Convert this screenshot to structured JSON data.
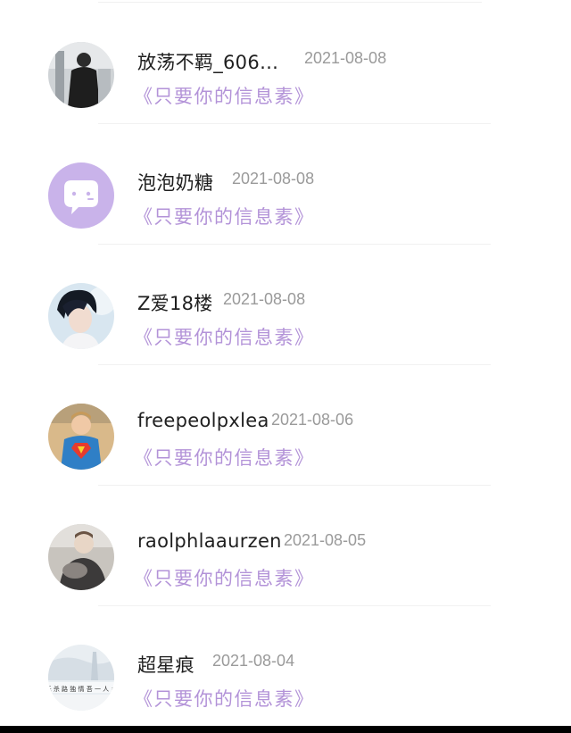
{
  "comments": [
    {
      "username": "放荡不羁_606…",
      "date": "2021-08-08",
      "book": "《只要你的信息素》",
      "avatar": "photo-person-dark"
    },
    {
      "username": "泡泡奶糖",
      "date": "2021-08-08",
      "book": "《只要你的信息素》",
      "avatar": "default-chat-bubble-icon"
    },
    {
      "username": "Z爱18楼",
      "date": "2021-08-08",
      "book": "《只要你的信息素》",
      "avatar": "photo-person-portrait"
    },
    {
      "username": "freepeolpxlea",
      "date": "2021-08-06",
      "book": "《只要你的信息素》",
      "avatar": "photo-child-superman"
    },
    {
      "username": "raolphlaaurzen",
      "date": "2021-08-05",
      "book": "《只要你的信息素》",
      "avatar": "photo-person-grey"
    },
    {
      "username": "超星痕",
      "date": "2021-08-04",
      "book": "《只要你的信息素》",
      "avatar": "photo-snow-text",
      "avatar_text": "无 杀 路 独 情 吾 一 人 乡"
    }
  ],
  "colors": {
    "book_link": "#b393d8",
    "date": "#9a9a9a",
    "username": "#1f1f1f",
    "default_avatar_bg": "#c9b3ea"
  }
}
